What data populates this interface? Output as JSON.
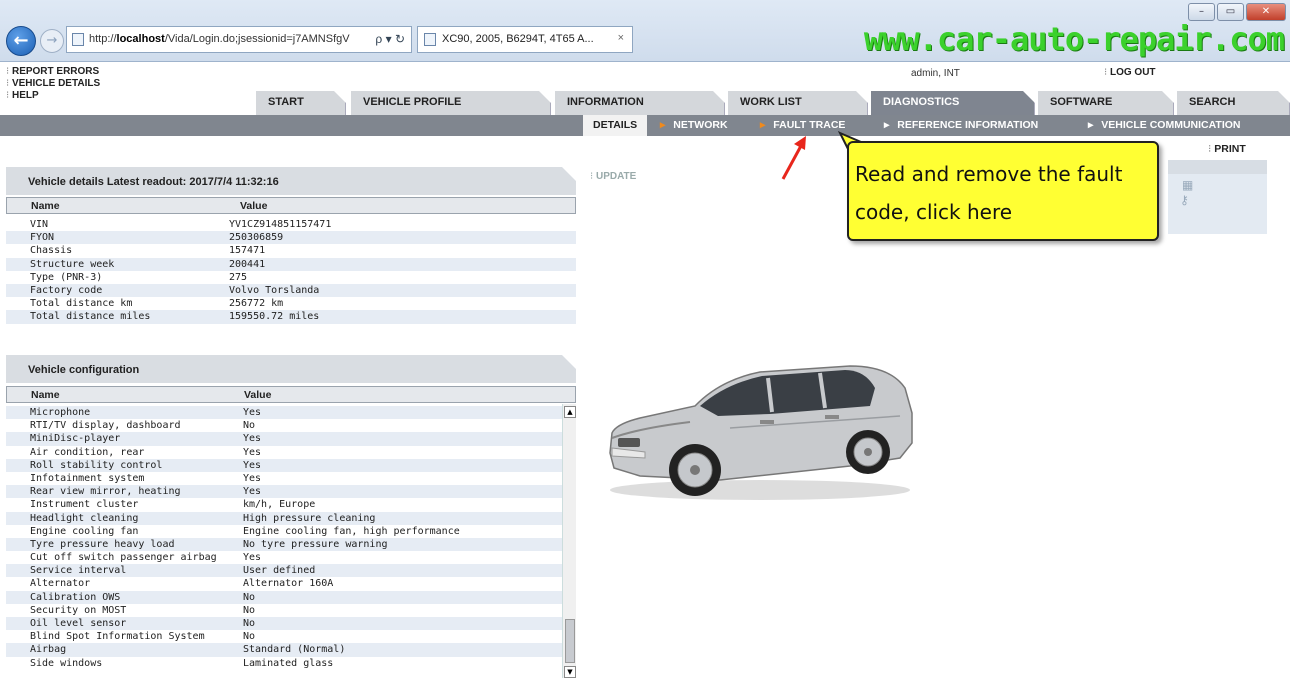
{
  "browser": {
    "back_icon": "back-arrow-icon",
    "address_prefix": "http://",
    "address_host": "localhost",
    "address_rest": "/Vida/Login.do;jsessionid=j7AMNSfgV",
    "address_tools": "ρ ▾ ↻",
    "tab_title": "XC90, 2005, B6294T, 4T65 A...",
    "tab_close": "×",
    "watermark": "www.car-auto-repair.com",
    "window_buttons": [
      "–",
      "▭",
      "✕"
    ]
  },
  "header": {
    "links": [
      "REPORT ERRORS",
      "VEHICLE DETAILS",
      "HELP"
    ],
    "user": "admin, INT",
    "logout": "LOG OUT"
  },
  "main_tabs": [
    "START",
    "VEHICLE PROFILE",
    "INFORMATION",
    "WORK LIST",
    "DIAGNOSTICS",
    "SOFTWARE",
    "SEARCH"
  ],
  "active_main_tab": "DIAGNOSTICS",
  "sub_tabs": [
    "DETAILS",
    "NETWORK",
    "FAULT TRACE",
    "REFERENCE INFORMATION",
    "VEHICLE COMMUNICATION"
  ],
  "active_sub_tab": "DETAILS",
  "vehicle_details": {
    "title": "Vehicle details   Latest readout: 2017/7/4 11:32:16",
    "col_name": "Name",
    "col_value": "Value",
    "rows": [
      {
        "name": "VIN",
        "value": "YV1CZ914851157471"
      },
      {
        "name": "FYON",
        "value": "250306859"
      },
      {
        "name": "Chassis",
        "value": "157471"
      },
      {
        "name": "Structure week",
        "value": "200441"
      },
      {
        "name": "Type (PNR-3)",
        "value": "275"
      },
      {
        "name": "Factory code",
        "value": "Volvo Torslanda"
      },
      {
        "name": "Total distance km",
        "value": "256772 km"
      },
      {
        "name": "Total distance miles",
        "value": "159550.72 miles"
      }
    ]
  },
  "vehicle_configuration": {
    "title": "Vehicle configuration",
    "col_name": "Name",
    "col_value": "Value",
    "rows": [
      {
        "name": "Microphone",
        "value": "Yes"
      },
      {
        "name": "RTI/TV display, dashboard",
        "value": "No"
      },
      {
        "name": "MiniDisc-player",
        "value": "Yes"
      },
      {
        "name": "Air condition, rear",
        "value": "Yes"
      },
      {
        "name": "Roll stability control",
        "value": "Yes"
      },
      {
        "name": "Infotainment system",
        "value": "Yes"
      },
      {
        "name": "Rear view mirror, heating",
        "value": "Yes"
      },
      {
        "name": "Instrument cluster",
        "value": "km/h, Europe"
      },
      {
        "name": "Headlight cleaning",
        "value": "High pressure cleaning"
      },
      {
        "name": "Engine cooling fan",
        "value": "Engine cooling fan, high performance"
      },
      {
        "name": "Tyre pressure heavy load",
        "value": "No tyre pressure warning"
      },
      {
        "name": "Cut off switch passenger airbag",
        "value": "Yes"
      },
      {
        "name": "Service interval",
        "value": "User defined"
      },
      {
        "name": "Alternator",
        "value": "Alternator 160A"
      },
      {
        "name": "Calibration OWS",
        "value": "No"
      },
      {
        "name": "Security on MOST",
        "value": "No"
      },
      {
        "name": "Oil level sensor",
        "value": "No"
      },
      {
        "name": "Blind Spot Information System",
        "value": "No"
      },
      {
        "name": "Airbag",
        "value": "Standard (Normal)"
      },
      {
        "name": "Side windows",
        "value": "Laminated glass"
      }
    ]
  },
  "actions": {
    "update": "UPDATE",
    "print": "PRINT"
  },
  "callout": {
    "line1": "Read and remove the fault",
    "line2": "code, click here"
  },
  "colors": {
    "active_tab_bg": "#7f8590",
    "callout_bg": "#ffff33",
    "sub_arrow": "#f08a1c",
    "watermark": "#3bd12c",
    "red_arrow": "#e8261c"
  }
}
